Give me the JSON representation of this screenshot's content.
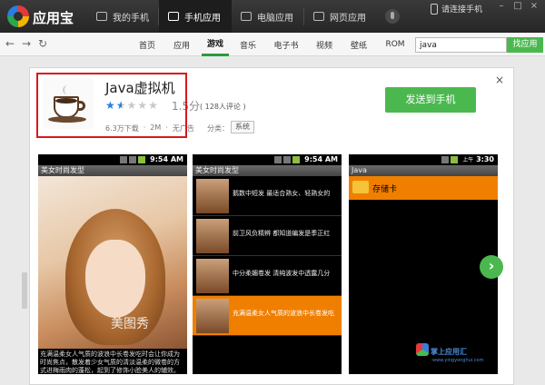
{
  "app": {
    "title": "应用宝"
  },
  "topnav": {
    "tabs": [
      {
        "label": "我的手机",
        "icon": "phone-icon",
        "active": false
      },
      {
        "label": "手机应用",
        "icon": "apps-icon",
        "active": true
      },
      {
        "label": "电脑应用",
        "icon": "monitor-icon",
        "active": false
      },
      {
        "label": "网页应用",
        "icon": "web-icon",
        "active": false
      }
    ],
    "connect_label": "请连接手机"
  },
  "categories": [
    {
      "label": "首页",
      "active": false
    },
    {
      "label": "应用",
      "active": false
    },
    {
      "label": "游戏",
      "active": true
    },
    {
      "label": "音乐",
      "active": false
    },
    {
      "label": "电子书",
      "active": false
    },
    {
      "label": "视频",
      "active": false
    },
    {
      "label": "壁纸",
      "active": false
    },
    {
      "label": "ROM",
      "active": false
    }
  ],
  "search": {
    "value": "java",
    "button_label": "找应用"
  },
  "app_detail": {
    "name": "Java虚拟机",
    "rating_score": "1.5分",
    "rating_value": 1.5,
    "rating_max": 5,
    "review_count": "( 128人评论 )",
    "downloads": "6.3万下载",
    "size": "2M",
    "ads": "无广告",
    "category_label": "分类：",
    "category_tag": "系统",
    "send_button": "发送到手机"
  },
  "screenshots": [
    {
      "status_time": "9:54 AM",
      "title": "美女时尚发型",
      "caption": "充满温柔女人气质的波浪中长卷发吃时会让你成为时尚焦点，散发着少女气质的清淡温柔的微卷的方式进梅雨肉的蓬松，起到了修饰小脸美人的辅效。",
      "watermark": "美图秀"
    },
    {
      "status_time": "9:54 AM",
      "title": "美女时尚发型",
      "items": [
        {
          "text": "鹅数中短发 最适合熟女、轻熟女的",
          "selected": false
        },
        {
          "text": "前卫风负精辨 都知道编发是季正红",
          "selected": false
        },
        {
          "text": "中分柔媚卷发 清纯波发中透露几分",
          "selected": false
        },
        {
          "text": "充满温柔女人气质的波浪中长卷发吃",
          "selected": true
        }
      ]
    },
    {
      "status_time_prefix": "上午",
      "status_time": "3:30",
      "title": "Java",
      "folder_label": "存储卡",
      "watermark": "掌上应用汇",
      "watermark_url": "www.yingyonghui.com"
    }
  ],
  "colors": {
    "accent_green": "#4bb84f",
    "highlight_red": "#d81919",
    "selection_orange": "#f07f00",
    "star_blue": "#2a7de1"
  }
}
